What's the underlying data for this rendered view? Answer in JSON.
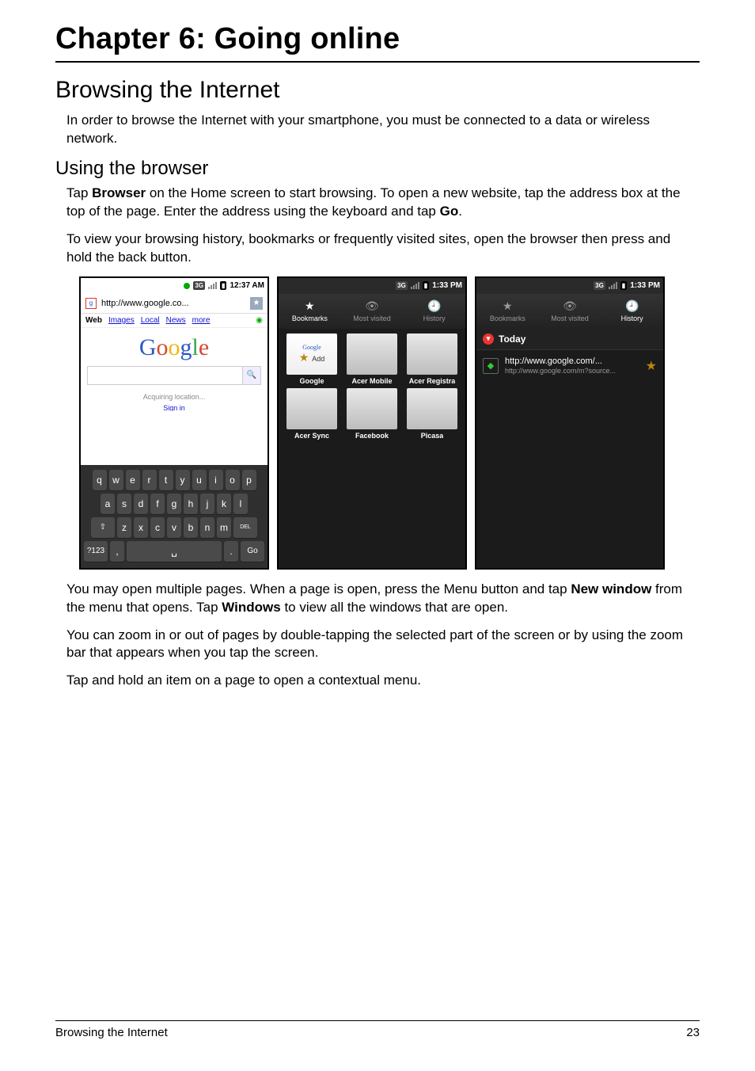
{
  "chapter_title": "Chapter 6: Going online",
  "section_title": "Browsing the Internet",
  "intro": "In order to browse the Internet with your smartphone, you must be connected to a data or wireless network.",
  "sub_title": "Using the browser",
  "para1a": "Tap ",
  "para1_bold1": "Browser",
  "para1b": " on the Home screen to start browsing. To open a new website, tap the address box at the top of the page. Enter the address using the keyboard and tap ",
  "para1_bold2": "Go",
  "para1c": ".",
  "para2": "To view your browsing history, bookmarks or frequently visited sites, open the browser then press and hold the back button.",
  "para3a": "You may open multiple pages. When a page is open, press the Menu button and tap ",
  "para3_bold1": "New window",
  "para3b": " from the menu that opens. Tap ",
  "para3_bold2": "Windows",
  "para3c": " to view all the windows that are open.",
  "para4": "You can zoom in or out of pages by double-tapping the selected part of the screen or by using the zoom bar that appears when you tap the screen.",
  "para5": "Tap and hold an item on a page to open a contextual menu.",
  "footer_left": "Browsing the Internet",
  "footer_right": "23",
  "shotA": {
    "time": "12:37 AM",
    "net_label": "3G",
    "url": "http://www.google.co...",
    "nav": {
      "web": "Web",
      "images": "Images",
      "local": "Local",
      "news": "News",
      "more": "more"
    },
    "logo": {
      "g1": "G",
      "o1": "o",
      "o2": "o",
      "g2": "g",
      "l": "l",
      "e": "e"
    },
    "acquiring": "Acquiring location...",
    "signin": "Sign in",
    "kb": {
      "row1": [
        "q",
        "w",
        "e",
        "r",
        "t",
        "y",
        "u",
        "i",
        "o",
        "p"
      ],
      "row2": [
        "a",
        "s",
        "d",
        "f",
        "g",
        "h",
        "j",
        "k",
        "l"
      ],
      "row3_shift": "⇧",
      "row3": [
        "z",
        "x",
        "c",
        "v",
        "b",
        "n",
        "m"
      ],
      "row3_del": "DEL",
      "row4_sym": "?123",
      "row4_comma": ",",
      "row4_dot": ".",
      "row4_go": "Go"
    }
  },
  "shotB": {
    "time": "1:33 PM",
    "net_label": "3G",
    "tabs": {
      "bookmarks": "Bookmarks",
      "most": "Most visited",
      "history": "History"
    },
    "add_big": "Google",
    "add_small": "Add",
    "cells": [
      "Google",
      "Acer Mobile",
      "Acer Registra",
      "Acer Sync",
      "Facebook",
      "Picasa"
    ]
  },
  "shotC": {
    "time": "1:33 PM",
    "net_label": "3G",
    "tabs": {
      "bookmarks": "Bookmarks",
      "most": "Most visited",
      "history": "History"
    },
    "today": "Today",
    "item_title": "http://www.google.com/...",
    "item_sub": "http://www.google.com/m?source..."
  }
}
